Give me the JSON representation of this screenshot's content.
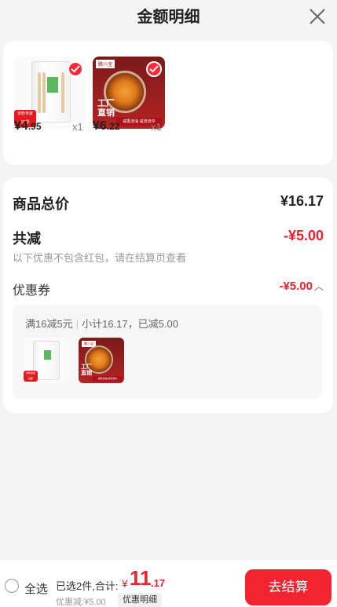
{
  "header": {
    "title": "金额明细"
  },
  "products": [
    {
      "currency": "¥",
      "price_int": "4",
      "price_dec": ".95",
      "qty": "x1",
      "tag_text": [
        "米粉世家",
        "旧都"
      ]
    },
    {
      "currency": "¥",
      "price_int": "6",
      "price_dec": ".22",
      "qty": "x1",
      "top_label": "腾八宝",
      "big_text": [
        "工厂",
        "直销"
      ],
      "strip_text": "咸香流油 咸流流中"
    }
  ],
  "summary": {
    "total_label": "商品总价",
    "total_value": "¥16.17",
    "reduce_label": "共减",
    "reduce_value": "-¥5.00",
    "note": "以下优惠不包含红包，请在结算页查看",
    "coupon_label": "优惠券",
    "coupon_value": "-¥5.00",
    "coupon_box": {
      "rule": "满16减5元",
      "calc": "小计16.17，已减5.00"
    }
  },
  "bottom": {
    "select_all": "全选",
    "selected_text": "已选2件,合计:",
    "currency": "¥",
    "amount_int": "11",
    "amount_dec": ".17",
    "discount": "优惠减:¥5.00",
    "detail_button": "优惠明细",
    "checkout_button": "去结算"
  },
  "colors": {
    "accent": "#f3232f",
    "price_red": "#e8232e"
  }
}
